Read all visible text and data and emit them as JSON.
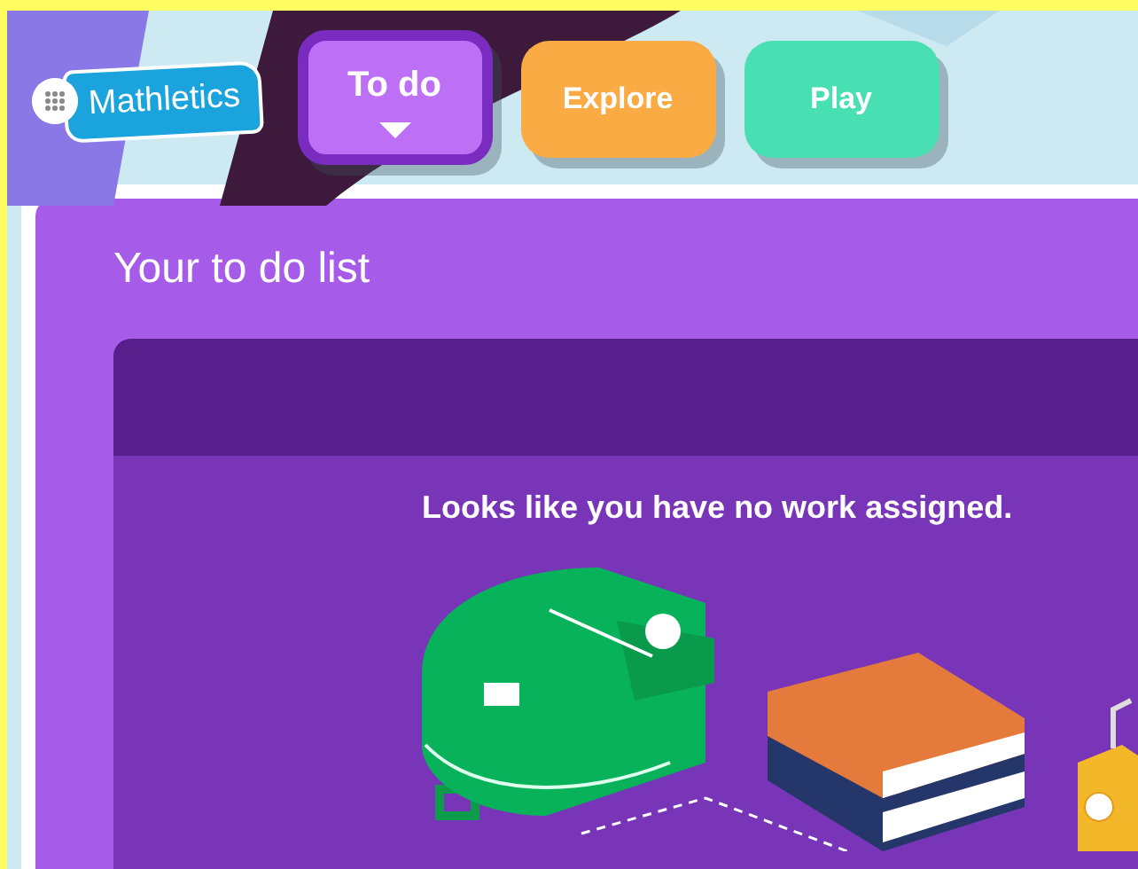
{
  "logo": {
    "text": "Mathletics"
  },
  "tabs": [
    {
      "label": "To do",
      "selected": true,
      "color": "#bd6ff5"
    },
    {
      "label": "Explore",
      "selected": false,
      "color": "#fbab44"
    },
    {
      "label": "Play",
      "selected": false,
      "color": "#48e0b2"
    }
  ],
  "panel": {
    "title": "Your to do list",
    "message": "Looks like you have no work assigned."
  }
}
